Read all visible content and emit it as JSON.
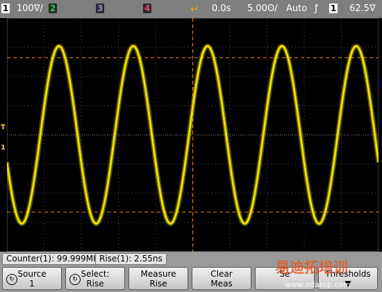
{
  "status_bar": {
    "ch1": {
      "number": "1",
      "scale": "100∇/",
      "color": "#f2e200"
    },
    "ch2": {
      "number": "2",
      "color": "#2fc34a"
    },
    "ch3": {
      "number": "3",
      "color": "#7e3ad0"
    },
    "ch4": {
      "number": "4",
      "color": "#e0455f"
    },
    "trigger_marker": "↵",
    "time_position": "0.0s",
    "time_scale": "5.00ʘ/",
    "trigger_mode": "Auto",
    "trigger_slope": "ƒ",
    "trigger_source": "1",
    "trigger_level": "62.5∇"
  },
  "left_markers": {
    "trigger_level": "T",
    "ground": "1"
  },
  "waveform": {
    "channel": "1",
    "color": "#f2e200",
    "frequency_mhz": 99.999,
    "cycles_on_screen": 5,
    "amplitude_fraction": 0.76,
    "phase_fraction": 0.05
  },
  "colors": {
    "grid": "#6b6b6b",
    "cursor": "#e07a16",
    "status_bg": "#7f7f7f",
    "softkey_bg": "#d9d9d9"
  },
  "readout": {
    "counter": "Counter(1): 99.999MHz",
    "rise": "Rise(1): 2.55ns"
  },
  "softkeys": [
    {
      "line1": "Source",
      "line2": "1",
      "icon": "dial-icon"
    },
    {
      "line1": "Select:",
      "line2": "Rise",
      "icon": "dial-icon"
    },
    {
      "line1": "Measure",
      "line2": "Rise"
    },
    {
      "line1": "Clear",
      "line2": "Meas"
    },
    {
      "line1": "Se",
      "line2": ""
    },
    {
      "line1": "Thresholds",
      "line2": "▼"
    }
  ],
  "watermark": {
    "line1": "易迪拓培训",
    "line2": "www.edatop.com"
  }
}
